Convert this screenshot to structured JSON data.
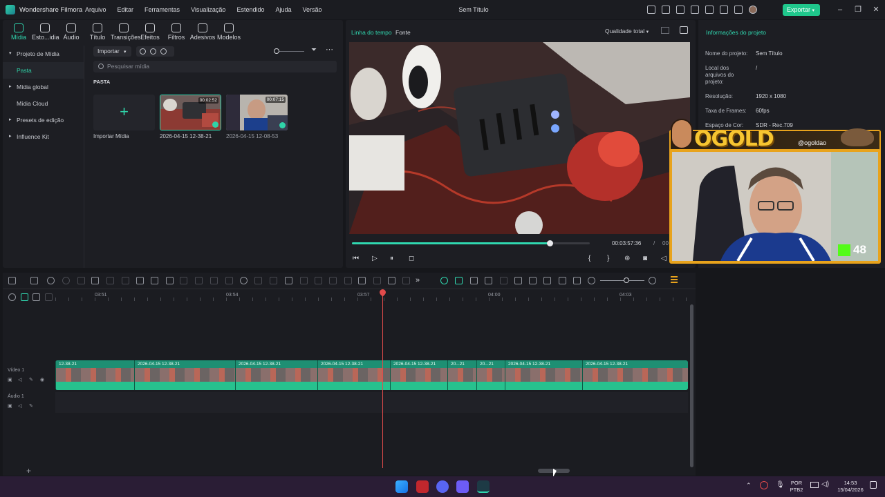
{
  "titlebar": {
    "app_name": "Wondershare Filmora",
    "menu": [
      "Arquivo",
      "Editar",
      "Ferramentas",
      "Visualização",
      "Estendido",
      "Ajuda",
      "Versão"
    ],
    "doc_title": "Sem Título",
    "export_label": "Exportar"
  },
  "media_panel": {
    "tabs": [
      {
        "label": "Mídia",
        "icon": "media-icon"
      },
      {
        "label": "Esto...idia",
        "icon": "stock-media-icon"
      },
      {
        "label": "Áudio",
        "icon": "music-note-icon"
      },
      {
        "label": "Título",
        "icon": "text-icon"
      },
      {
        "label": "Transições",
        "icon": "transition-icon"
      },
      {
        "label": "Efeitos",
        "icon": "effects-icon"
      },
      {
        "label": "Filtros",
        "icon": "filter-icon"
      },
      {
        "label": "Adesivos",
        "icon": "sticker-icon"
      },
      {
        "label": "Modelos",
        "icon": "template-icon"
      }
    ],
    "sidebar": [
      {
        "label": "Projeto de Mídia",
        "caret": "▾"
      },
      {
        "label": "Pasta",
        "caret": ""
      },
      {
        "label": "Mídia global",
        "caret": "▸"
      },
      {
        "label": "Mídia Cloud",
        "caret": ""
      },
      {
        "label": "Presets de edição",
        "caret": "▸"
      },
      {
        "label": "Influence Kit",
        "caret": "▸"
      }
    ],
    "import_label": "Importar",
    "search_placeholder": "Pesquisar mídia",
    "folder_label": "PASTA",
    "import_tile_label": "Importar Mídia",
    "clips": [
      {
        "name": "2026-04-15 12-38-21",
        "duration": "00:02:52"
      },
      {
        "name": "2026-04-15 12-08-53",
        "duration": "00:07:15"
      }
    ]
  },
  "preview": {
    "tab_timeline": "Linha do tempo",
    "tab_source": "Fonte",
    "quality": "Qualidade total",
    "current_time": "00:03:57:36",
    "separator": "/",
    "total_time": "00",
    "progress": 0.83
  },
  "info_panel": {
    "title": "Informações do projeto",
    "rows": [
      {
        "label": "Nome do projeto:",
        "value": "Sem Título"
      },
      {
        "label": "Local dos arquivos do projeto:",
        "value": "/"
      },
      {
        "label": "Resolução:",
        "value": "1920 x 1080"
      },
      {
        "label": "Taxa de Frames:",
        "value": "60fps"
      },
      {
        "label": "Espaço de Cor:",
        "value": "SDR - Rec.709"
      }
    ]
  },
  "webcam": {
    "brand": "OGOLD",
    "handle": "@ogoldao",
    "viewer_count": "48"
  },
  "timeline": {
    "ruler": [
      "03:51",
      "03:54",
      "03:57",
      "04:00",
      "04:03"
    ],
    "track_video": "Vídeo 1",
    "track_audio": "Áudio 1",
    "clips": [
      {
        "label": "12-38-21"
      },
      {
        "label": "2026-04-15 12-38-21"
      },
      {
        "label": "2026-04-15 12-38-21"
      },
      {
        "label": "2026-04-15 12-38-21"
      },
      {
        "label": "2026-04-15 12-38-21"
      },
      {
        "label": "20...21"
      },
      {
        "label": "20...21"
      },
      {
        "label": "2026-04-15 12-38-21"
      },
      {
        "label": "2026-04-15 12-38-21"
      }
    ]
  },
  "taskbar": {
    "lang": "POR",
    "layout": "PTB2",
    "time": "14:53",
    "date": "15/04/2026"
  },
  "colors": {
    "accent": "#30d8b0",
    "export": "#1fc78c",
    "playhead": "#e24b4b",
    "track": "#1e8f73"
  }
}
